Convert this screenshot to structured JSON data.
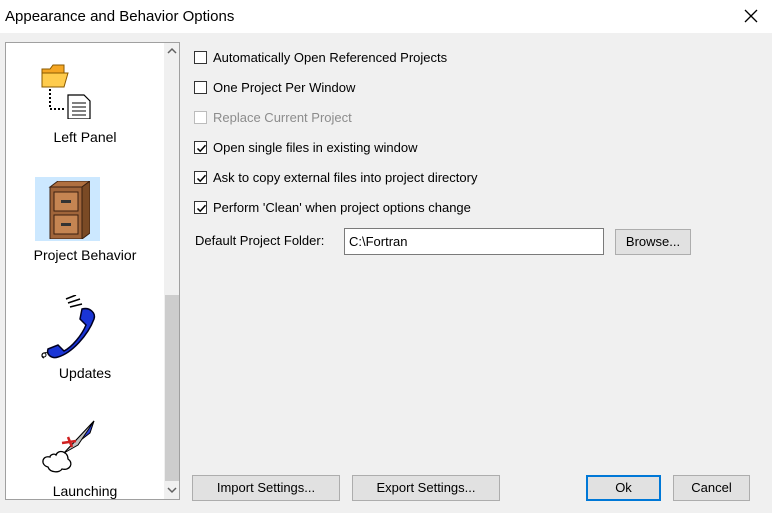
{
  "window": {
    "title": "Appearance and Behavior Options"
  },
  "sidebar": {
    "items": [
      {
        "label": "Left Panel",
        "icon": "folder-tree-icon",
        "selected": false
      },
      {
        "label": "Project Behavior",
        "icon": "file-cabinet-icon",
        "selected": true
      },
      {
        "label": "Updates",
        "icon": "telephone-icon",
        "selected": false
      },
      {
        "label": "Launching",
        "icon": "rocket-icon",
        "selected": false
      }
    ]
  },
  "options": [
    {
      "label": "Automatically Open Referenced Projects",
      "checked": false,
      "enabled": true
    },
    {
      "label": "One Project Per Window",
      "checked": false,
      "enabled": true
    },
    {
      "label": "Replace Current Project",
      "checked": false,
      "enabled": false
    },
    {
      "label": "Open single files in existing window",
      "checked": true,
      "enabled": true
    },
    {
      "label": "Ask to copy external files into project directory",
      "checked": true,
      "enabled": true
    },
    {
      "label": "Perform 'Clean' when project options change",
      "checked": true,
      "enabled": true
    }
  ],
  "folder": {
    "label": "Default Project Folder:",
    "value": "C:\\Fortran",
    "browse_label": "Browse..."
  },
  "buttons": {
    "import_label": "Import Settings...",
    "export_label": "Export Settings...",
    "ok_label": "Ok",
    "cancel_label": "Cancel"
  },
  "colors": {
    "selection": "#cce8ff",
    "accent": "#0078d7",
    "checkmark": "#000000"
  }
}
